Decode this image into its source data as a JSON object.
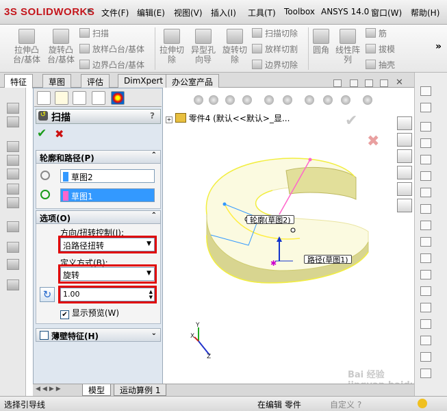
{
  "app": {
    "logo": "SOLIDWORKS",
    "logo_prefix": "3S"
  },
  "menu": [
    "文件(F)",
    "编辑(E)",
    "视图(V)",
    "插入(I)",
    "工具(T)",
    "Toolbox",
    "ANSYS 14.0",
    "窗口(W)",
    "帮助(H)"
  ],
  "toolbar": {
    "extrude_boss": "拉伸凸\n台/基体",
    "revolve_boss": "旋转凸\n台/基体",
    "sweep": "扫描",
    "loft": "放样凸台/基体",
    "boundary": "边界凸台/基体",
    "extrude_cut": "拉伸切\n除",
    "hole_wizard": "异型孔\n向导",
    "revolve_cut": "旋转切\n除",
    "swept_cut": "扫描切除",
    "lofted_cut": "放样切割",
    "boundary_cut": "边界切除",
    "fillet": "圆角",
    "linear_pattern": "线性阵\n列",
    "rib": "筋",
    "draft": "拔模",
    "shell": "抽壳",
    "more": "»"
  },
  "tabs": [
    "特征",
    "草图",
    "评估",
    "DimXpert",
    "办公室产品"
  ],
  "property_manager": {
    "title": "扫描",
    "help": "?",
    "ok": "✔",
    "cancel": "✖",
    "group_profile_path": "轮廓和路径(P)",
    "profile_value": "草图2",
    "path_value": "草图1",
    "group_options": "选项(O)",
    "orientation_label": "方向/扭转控制(I):",
    "orientation_value": "沿路径扭转",
    "define_label": "定义方式(B):",
    "define_value": "旋转",
    "twist_value": "1.00",
    "show_preview": "显示预览(W)",
    "group_thin": "薄壁特征(H)"
  },
  "feature_tree": {
    "root": "零件4  (默认<<默认>_显..."
  },
  "callouts": {
    "profile": "轮廓(草图2)",
    "path": "路径(草图1)"
  },
  "triad": {
    "x": "X",
    "y": "Y",
    "z": "Z"
  },
  "bottom_tabs": [
    "模型",
    "运动算例 1"
  ],
  "status": {
    "left": "选择引导线",
    "center": "在编辑 零件",
    "right": "自定义 ?"
  },
  "watermark": "Bai 经验\njingyan.baidu.com",
  "colors": {
    "accent_red": "#e00000",
    "model_yellow": "#f3f0b0",
    "selection_blue": "#3399ff",
    "pink_path": "#ff66cc"
  }
}
